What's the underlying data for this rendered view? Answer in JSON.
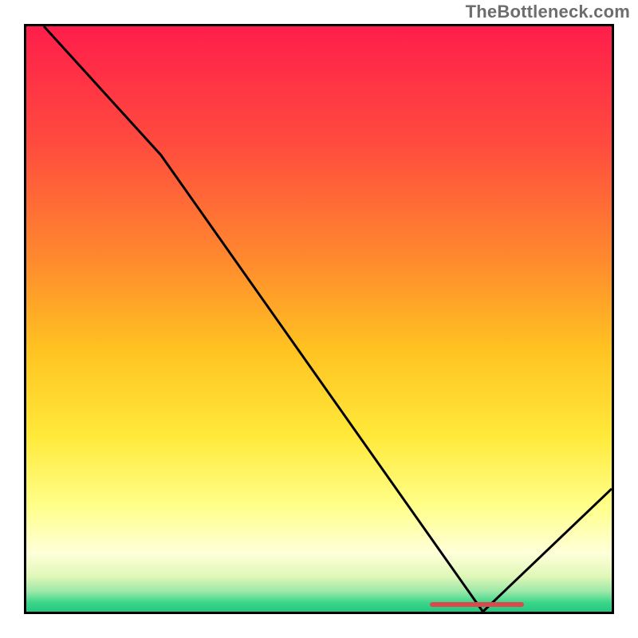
{
  "watermark": "TheBottleneck.com",
  "colors": {
    "border": "#000000",
    "curve": "#000000",
    "marker": "#d94a4f",
    "gradient_stops": [
      {
        "offset": 0.0,
        "color": "#ff1e4b"
      },
      {
        "offset": 0.2,
        "color": "#ff4b3e"
      },
      {
        "offset": 0.4,
        "color": "#ff8a2e"
      },
      {
        "offset": 0.55,
        "color": "#ffc221"
      },
      {
        "offset": 0.7,
        "color": "#ffe93a"
      },
      {
        "offset": 0.82,
        "color": "#ffff8a"
      },
      {
        "offset": 0.9,
        "color": "#ffffd9"
      },
      {
        "offset": 0.94,
        "color": "#dff7b8"
      },
      {
        "offset": 0.965,
        "color": "#9de8a8"
      },
      {
        "offset": 0.985,
        "color": "#39d68a"
      },
      {
        "offset": 1.0,
        "color": "#25c77e"
      }
    ]
  },
  "marker": {
    "x_frac_start": 0.69,
    "x_frac_end": 0.85,
    "y_frac": 0.988
  },
  "chart_data": {
    "type": "line",
    "title": "",
    "xlabel": "",
    "ylabel": "",
    "xlim": [
      0,
      100
    ],
    "ylim": [
      0,
      100
    ],
    "grid": false,
    "series": [
      {
        "name": "curve",
        "points": [
          {
            "x": 3,
            "y": 100
          },
          {
            "x": 23,
            "y": 78
          },
          {
            "x": 78,
            "y": 0
          },
          {
            "x": 100,
            "y": 21
          }
        ]
      }
    ],
    "highlight_range_x": [
      69,
      85
    ]
  }
}
